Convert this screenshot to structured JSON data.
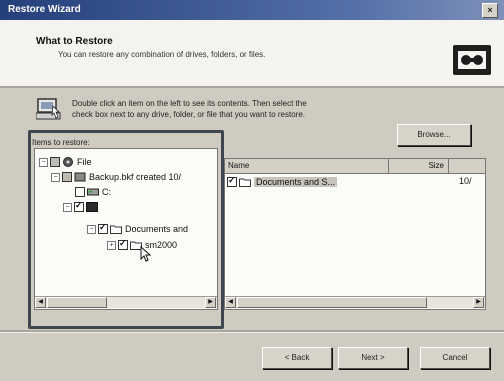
{
  "window": {
    "title": "Restore Wizard",
    "close_label": "×"
  },
  "header": {
    "title": "What to Restore",
    "subtitle": "You can restore any combination of drives, folders, or files."
  },
  "instructions": {
    "line1": "Double click an item on the left to see its contents. Then select the",
    "line2": "check box next to any drive, folder, or file that you want to restore."
  },
  "items_label": "Items to restore:",
  "browse_label": "Browse...",
  "tree": {
    "rows": [
      {
        "label": "File"
      },
      {
        "label": "Backup.bkf created 10/"
      },
      {
        "label": "C:"
      },
      {
        "label": ""
      },
      {
        "label": "Documents and"
      },
      {
        "label": "sm2000"
      }
    ]
  },
  "list": {
    "columns": {
      "name": "Name",
      "size": "Size"
    },
    "rows": [
      {
        "name": "Documents and S...",
        "size": "10/"
      }
    ]
  },
  "buttons": {
    "back": "< Back",
    "next": "Next >",
    "cancel": "Cancel"
  },
  "icons": {
    "header": "backup-tape-icon",
    "instructions": "computer-icon",
    "file": "file-icon",
    "drive": "drive-icon",
    "folder": "folder-icon",
    "cursor": "mouse-pointer-icon"
  },
  "colors": {
    "titlebar": "#243f7a",
    "highlight_border": "#3e4750",
    "dialog_bg": "#cfcbc1"
  }
}
